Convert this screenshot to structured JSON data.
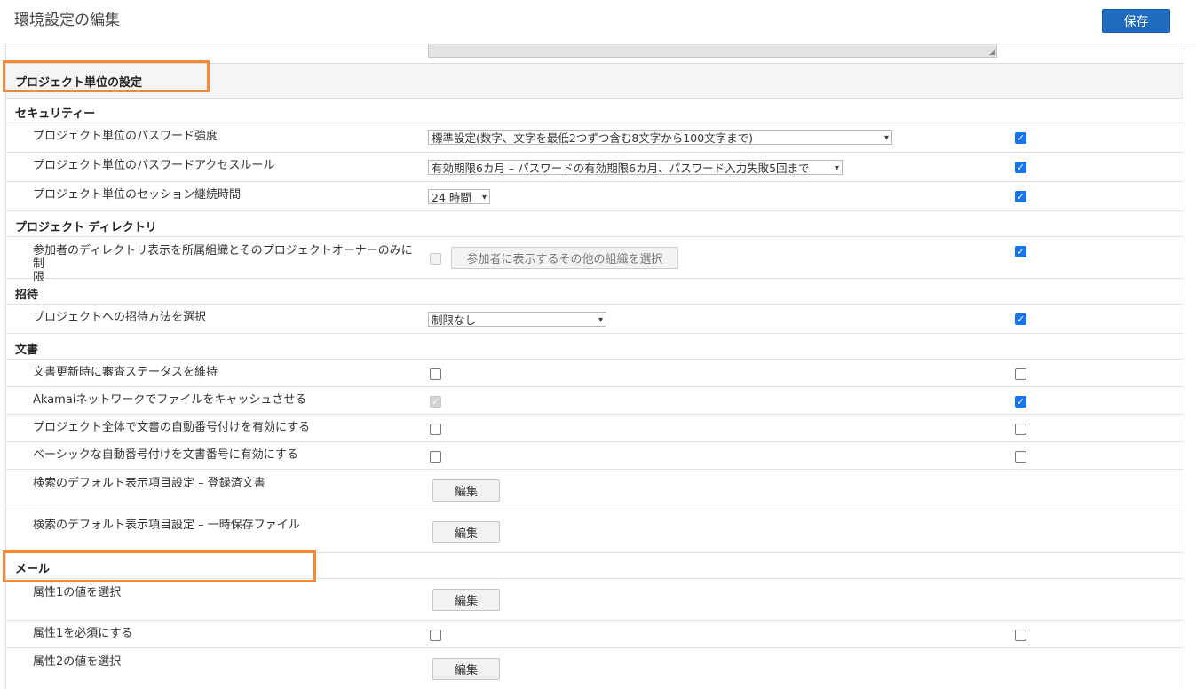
{
  "header": {
    "title": "環境設定の編集",
    "save_label": "保存"
  },
  "section": {
    "title": "プロジェクト単位の設定"
  },
  "groups": {
    "security": "セキュリティー",
    "directory": "プロジェクト ディレクトリ",
    "invite": "招待",
    "documents": "文書",
    "mail": "メール"
  },
  "settings": {
    "password_strength": {
      "label": "プロジェクト単位のパスワード強度",
      "value": "標準設定(数字、文字を最低2つずつ含む8文字から100文字まで)",
      "override": true
    },
    "password_access": {
      "label": "プロジェクト単位のパスワードアクセスルール",
      "value": "有効期限6カ月 – パスワードの有効期限6カ月、パスワード入力失敗5回まで",
      "override": true
    },
    "session": {
      "label": "プロジェクト単位のセッション継続時間",
      "value": "24 時間",
      "override": true
    },
    "directory_restrict": {
      "label_line1": "参加者のディレクトリ表示を所属組織とそのプロジェクトオーナーのみに制",
      "label_line2": "限",
      "button": "参加者に表示するその他の組織を選択",
      "value": false,
      "override": true
    },
    "invite_method": {
      "label": "プロジェクトへの招待方法を選択",
      "value": "制限なし",
      "override": true
    },
    "keep_review": {
      "label": "文書更新時に審査ステータスを維持",
      "value": false,
      "override": false
    },
    "akamai": {
      "label": "Akamaiネットワークでファイルをキャッシュさせる",
      "value": true,
      "override": true
    },
    "auto_number": {
      "label": "プロジェクト全体で文書の自動番号付けを有効にする",
      "value": false,
      "override": false
    },
    "basic_number": {
      "label": "ベーシックな自動番号付けを文書番号に有効にする",
      "value": false,
      "override": false
    },
    "search_registered": {
      "label": "検索のデフォルト表示項目設定 – 登録済文書",
      "button": "編集"
    },
    "search_temp": {
      "label": "検索のデフォルト表示項目設定 – 一時保存ファイル",
      "button": "編集"
    },
    "attr1_values": {
      "label": "属性1の値を選択",
      "button": "編集"
    },
    "attr1_required": {
      "label": "属性1を必須にする",
      "value": false,
      "override": false
    },
    "attr2_values": {
      "label": "属性2の値を選択",
      "button": "編集"
    }
  },
  "icons": {
    "dropdown": "chevron-down-icon",
    "checkmark": "checkmark-icon",
    "resize": "resize-grip-icon"
  },
  "colors": {
    "primary": "#1f6cbf",
    "checkbox": "#1a73e8",
    "highlight": "#f28a3a"
  }
}
